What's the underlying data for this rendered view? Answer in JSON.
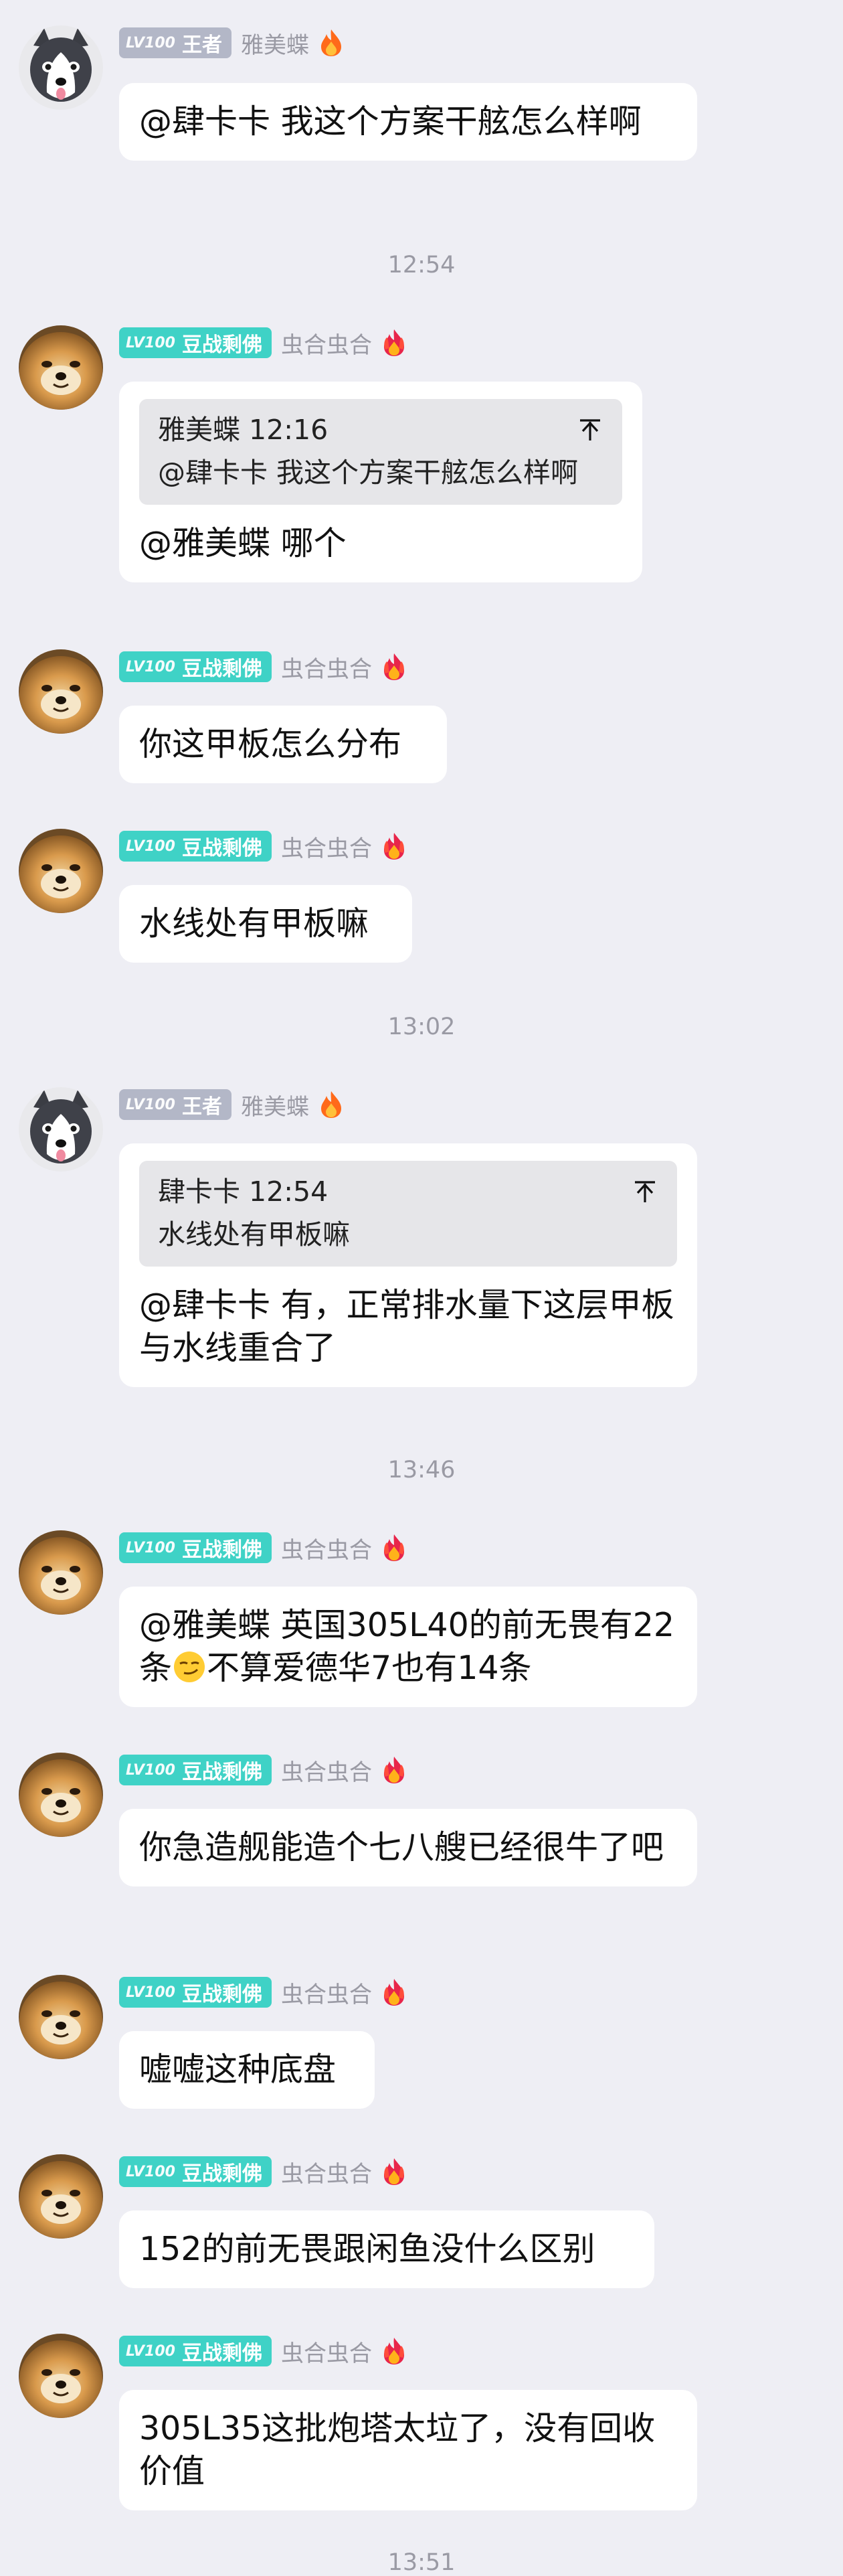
{
  "users": {
    "yameidie": {
      "level": "LV100",
      "title": "王者",
      "name": "雅美蝶"
    },
    "chonghe": {
      "level": "LV100",
      "title": "豆战剩佛",
      "name": "虫合虫合"
    }
  },
  "timestamps": [
    "12:54",
    "13:02",
    "13:46",
    "13:51"
  ],
  "messages": [
    {
      "text": "@肆卡卡 我这个方案干舷怎么样啊"
    },
    {
      "quote_head": "雅美蝶 12:16",
      "quote_text": "@肆卡卡 我这个方案干舷怎么样啊",
      "text": "@雅美蝶 哪个"
    },
    {
      "text": "你这甲板怎么分布"
    },
    {
      "text": "水线处有甲板嘛"
    },
    {
      "quote_head": "肆卡卡 12:54",
      "quote_text": "水线处有甲板嘛",
      "text": "@肆卡卡 有，正常排水量下这层甲板与水线重合了"
    },
    {
      "text_a": "@雅美蝶 英国305L40的前无畏有22条",
      "text_b": "不算爱德华7也有14条",
      "emoji": "smirk-emoji"
    },
    {
      "text": "你急造舰能造个七八艘已经很牛了吧"
    },
    {
      "text": "嘘嘘这种底盘"
    },
    {
      "text": "152的前无畏跟闲鱼没什么区别"
    },
    {
      "text": "305L35这批炮塔太垃了，没有回收价值"
    }
  ],
  "icons": {
    "quote_jump": "jump-to-quote-icon",
    "flame": "flame-icon"
  },
  "colors": {
    "background": "#eeeef4",
    "badge_gray": "#b3b7c7",
    "badge_teal": "#3fd2c6",
    "bubble": "#ffffff",
    "quote_bg": "#e6e6e9"
  }
}
